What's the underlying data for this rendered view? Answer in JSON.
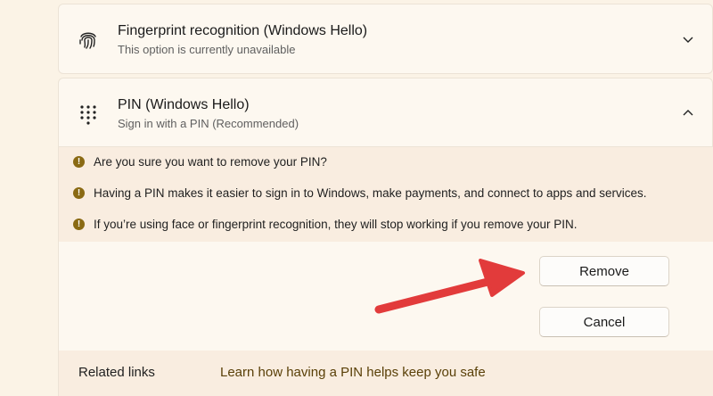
{
  "fingerprint": {
    "title": "Fingerprint recognition (Windows Hello)",
    "subtitle": "This option is currently unavailable",
    "icon": "fingerprint-icon"
  },
  "pin": {
    "title": "PIN (Windows Hello)",
    "subtitle": "Sign in with a PIN (Recommended)",
    "icon": "keypad-icon"
  },
  "warnings": [
    "Are you sure you want to remove your PIN?",
    "Having a PIN makes it easier to sign in to Windows, make payments, and connect to apps and services.",
    "If you’re using face or fingerprint recognition, they will stop working if you remove your PIN."
  ],
  "warning_glyph": "!",
  "buttons": {
    "remove": "Remove",
    "cancel": "Cancel"
  },
  "related": {
    "label": "Related links",
    "link": "Learn how having a PIN helps keep you safe"
  },
  "colors": {
    "warning_icon": "#8a6a13",
    "annotation_arrow": "#e23b3b",
    "link": "#5a4008"
  }
}
